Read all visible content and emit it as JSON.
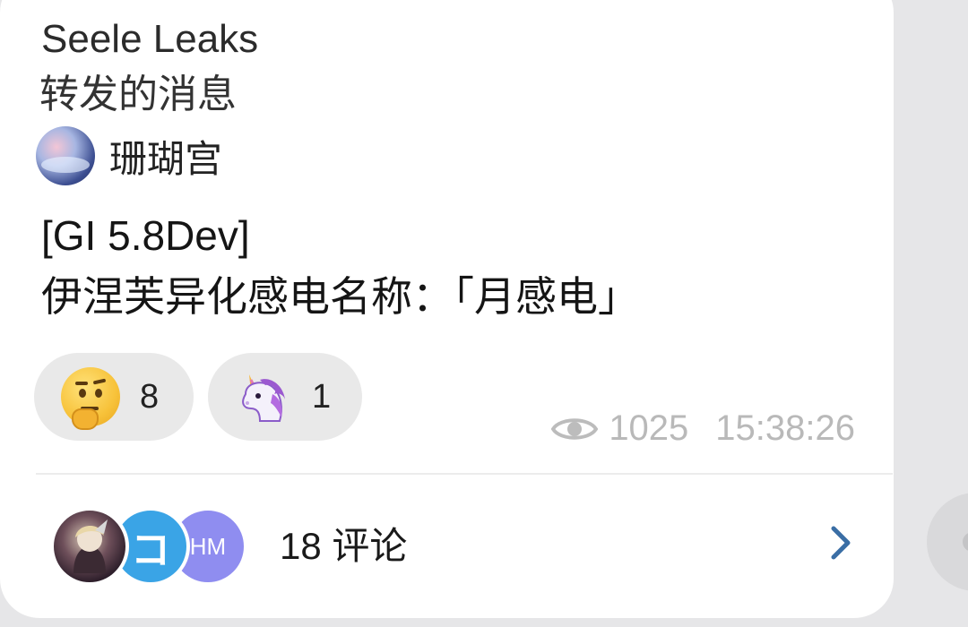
{
  "post": {
    "channel_name": "Seele Leaks",
    "forward_label": "转发的消息",
    "source_name": "珊瑚宫",
    "message_lines": [
      "[GI 5.8Dev]",
      "伊涅芙异化感电名称：「月感电」"
    ]
  },
  "reactions": [
    {
      "icon": "thinking-face-icon",
      "count": "8"
    },
    {
      "icon": "unicorn-icon",
      "count": "1"
    }
  ],
  "meta": {
    "views": "1025",
    "time": "15:38:26"
  },
  "comments": {
    "avatar_initials": [
      "",
      "コ",
      "HM"
    ],
    "count_label": "18 评论"
  },
  "colors": {
    "bubble_bg": "#ffffff",
    "page_bg": "#e6e6e8",
    "chevron": "#3a6ea5",
    "meta_text": "#b9b9b9"
  }
}
